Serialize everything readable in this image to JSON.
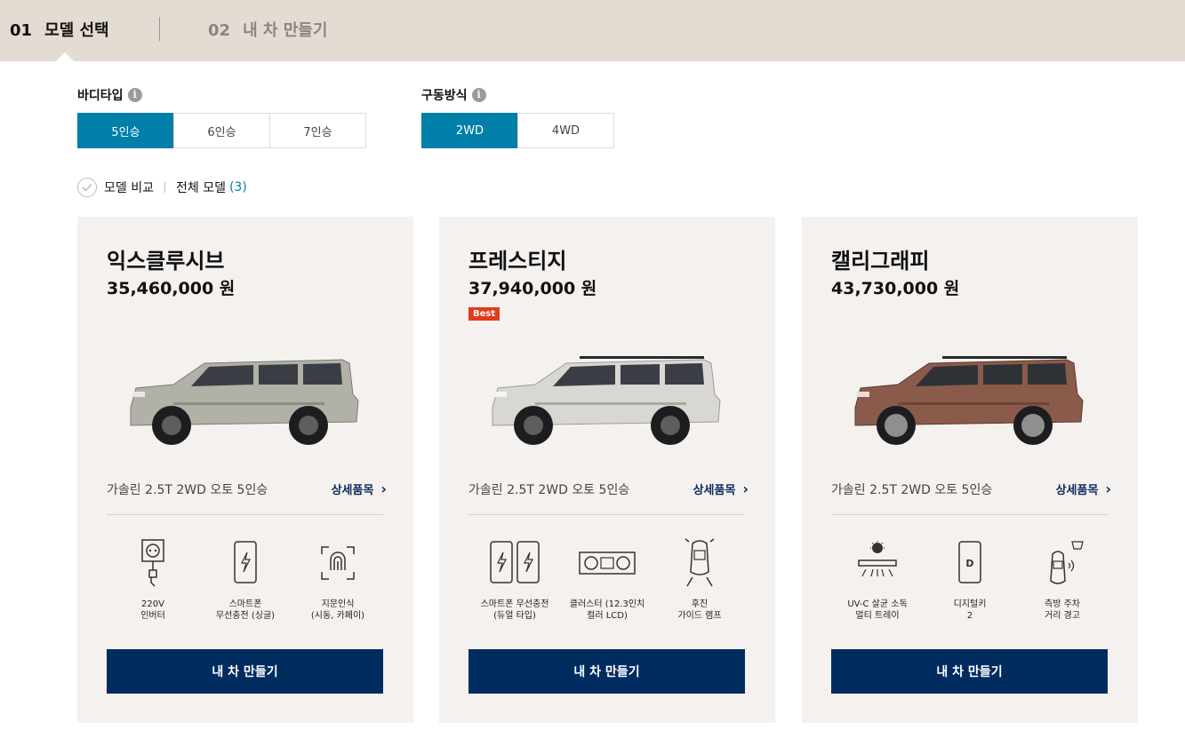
{
  "steps": [
    {
      "num": "01",
      "label": "모델 선택"
    },
    {
      "num": "02",
      "label": "내 차 만들기"
    }
  ],
  "filters": {
    "body": {
      "title": "바디타입",
      "options": [
        "5인승",
        "6인승",
        "7인승"
      ],
      "selected": "5인승"
    },
    "drive": {
      "title": "구동방식",
      "options": [
        "2WD",
        "4WD"
      ],
      "selected": "2WD"
    }
  },
  "compare": {
    "label": "모델 비교",
    "all_label": "전체 모델",
    "count": "(3)"
  },
  "cards": [
    {
      "name": "익스클루시브",
      "price": "35,460,000 원",
      "badge": "",
      "spec": "가솔린 2.5T 2WD 오토 5인승",
      "detail": "상세품목",
      "car_color": "#b2b1a8",
      "features": [
        {
          "icon": "outlet-icon",
          "l1": "220V",
          "l2": "인버터"
        },
        {
          "icon": "phone-wireless-charge-icon",
          "l1": "스마트폰",
          "l2": "무선충전 (싱글)"
        },
        {
          "icon": "fingerprint-icon",
          "l1": "지문인식",
          "l2": "(시동, 카페이)"
        }
      ],
      "cta": "내 차 만들기"
    },
    {
      "name": "프레스티지",
      "price": "37,940,000 원",
      "badge": "Best",
      "spec": "가솔린 2.5T 2WD 오토 5인승",
      "detail": "상세품목",
      "car_color": "#d8d7d2",
      "features": [
        {
          "icon": "dual-phone-charge-icon",
          "l1": "스마트폰 무선충전",
          "l2": "(듀얼 타입)"
        },
        {
          "icon": "cluster-display-icon",
          "l1": "클러스터 (12.3인치",
          "l2": "컬러 LCD)"
        },
        {
          "icon": "reverse-guide-lamp-icon",
          "l1": "후진",
          "l2": "가이드 램프"
        }
      ],
      "cta": "내 차 만들기"
    },
    {
      "name": "캘리그래피",
      "price": "43,730,000 원",
      "badge": "",
      "spec": "가솔린 2.5T 2WD 오토 5인승",
      "detail": "상세품목",
      "car_color": "#8a5a4a",
      "features": [
        {
          "icon": "uvc-tray-icon",
          "l1": "UV-C 살균 소독",
          "l2": "멀티 트레이"
        },
        {
          "icon": "digital-key-icon",
          "l1": "디지털키",
          "l2": "2"
        },
        {
          "icon": "side-parking-warning-icon",
          "l1": "측방 주차",
          "l2": "거리 경고"
        }
      ],
      "cta": "내 차 만들기"
    }
  ]
}
